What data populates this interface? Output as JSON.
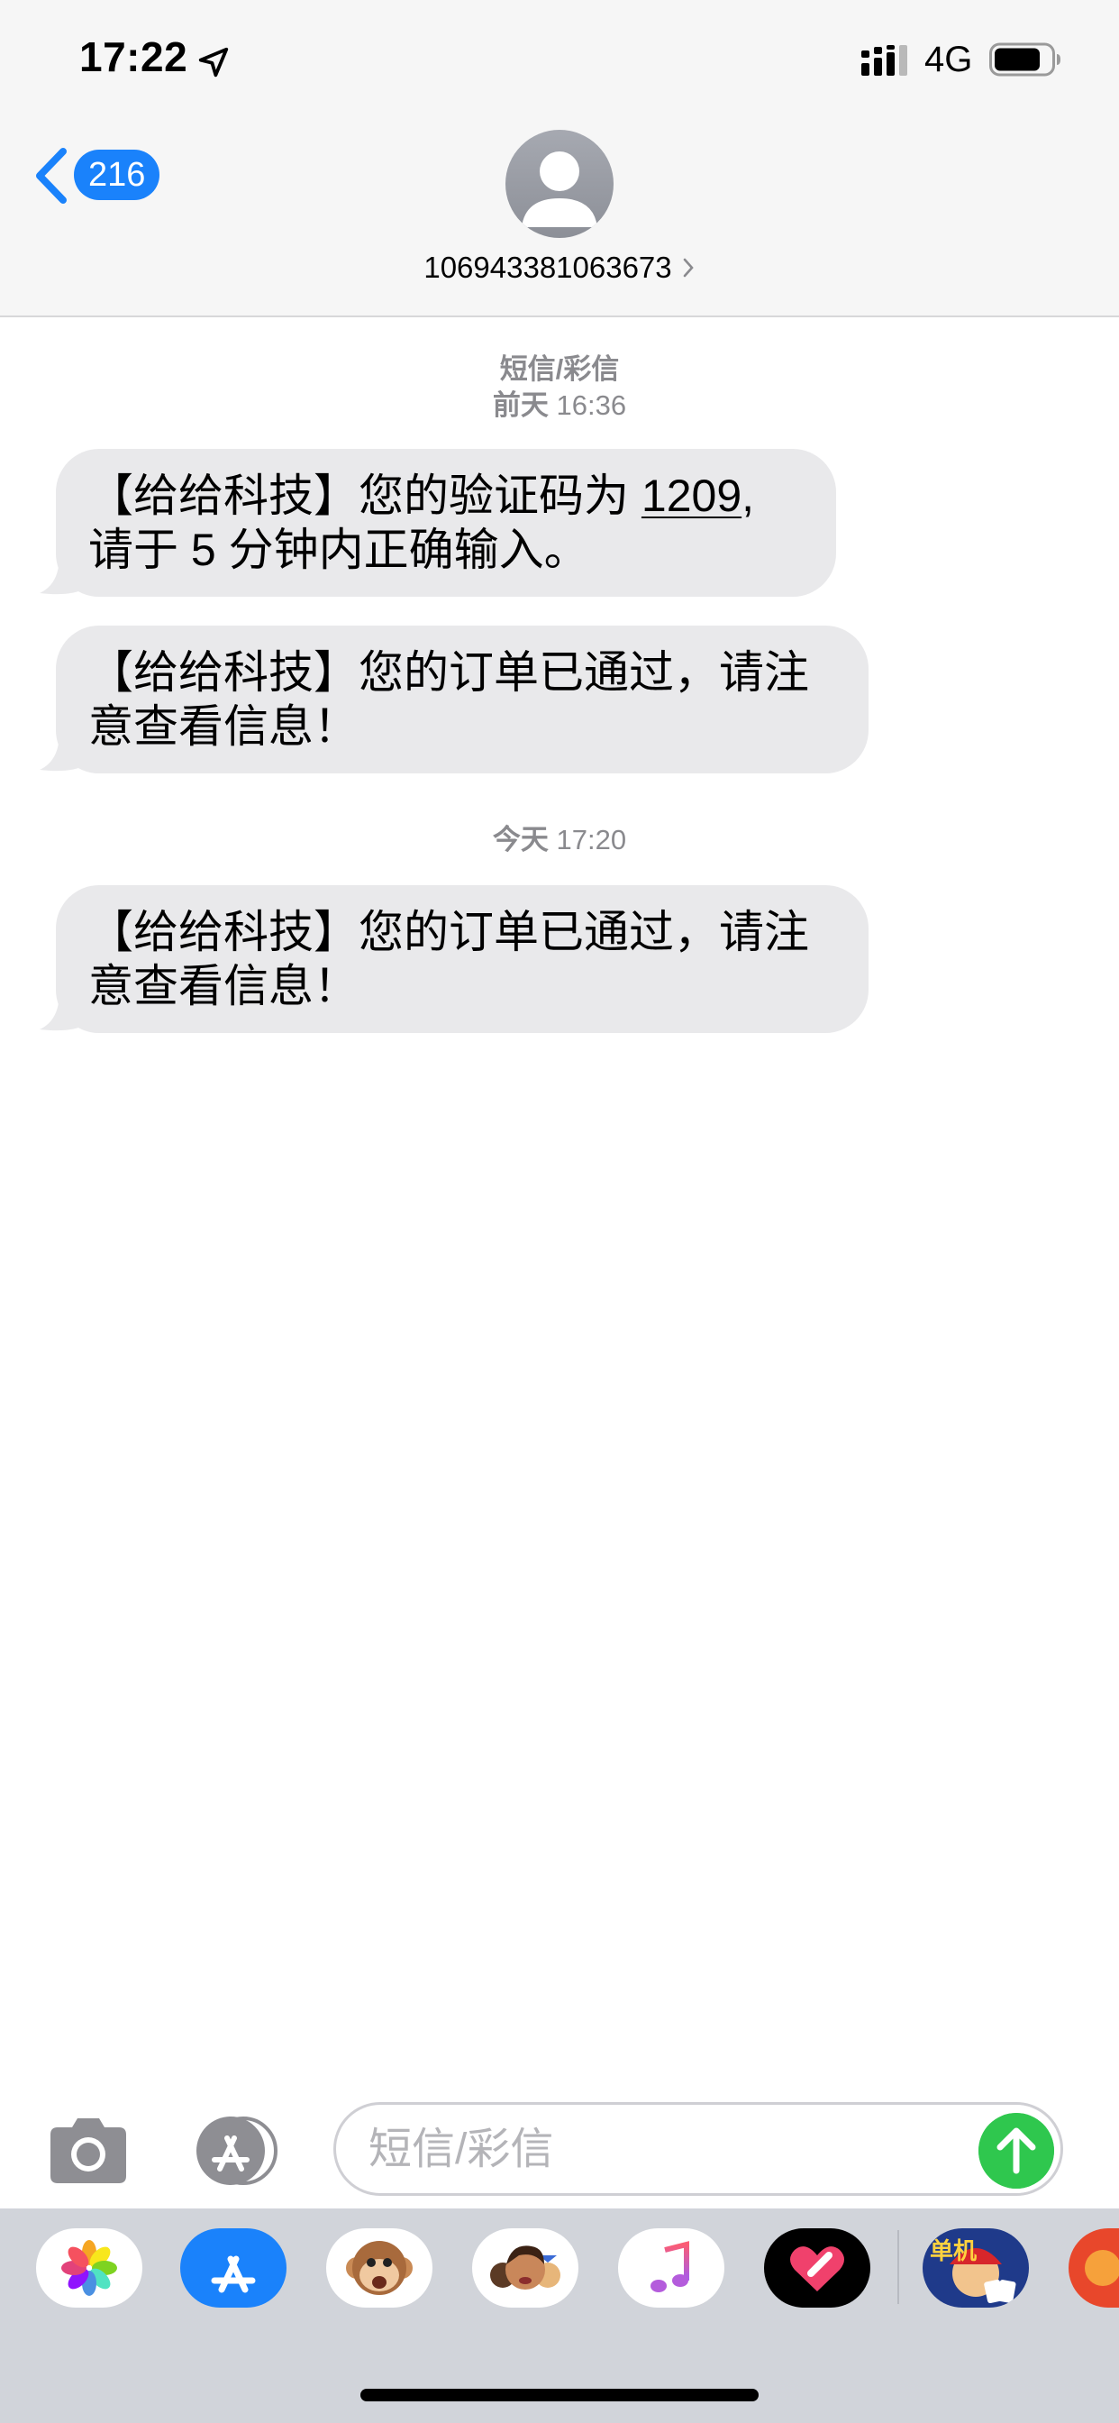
{
  "status_bar": {
    "time": "17:22",
    "network": "4G",
    "icons": [
      "location-arrow-icon",
      "signal-bars-icon",
      "battery-icon"
    ]
  },
  "header": {
    "back_badge": "216",
    "contact_number": "106943381063673",
    "icons": [
      "back-chevron-icon",
      "avatar-person-icon",
      "chevron-right-icon"
    ]
  },
  "conversation": {
    "service_label": "短信/彩信",
    "groups": [
      {
        "timestamp_day": "前天",
        "timestamp_time": "16:36",
        "messages": [
          {
            "line1_prefix": "【给给科技】您的验证码为 ",
            "code": "1209",
            "line1_suffix": ",",
            "line2": "请于 5 分钟内正确输入。"
          },
          {
            "line1": "【给给科技】您的订单已通过，请注",
            "line2": "意查看信息！"
          }
        ]
      },
      {
        "timestamp_day": "今天",
        "timestamp_time": "17:20",
        "messages": [
          {
            "line1": "【给给科技】您的订单已通过，请注",
            "line2": "意查看信息！"
          }
        ]
      }
    ]
  },
  "input_bar": {
    "placeholder": "短信/彩信",
    "icons": [
      "camera-icon",
      "app-store-icon",
      "send-arrow-icon"
    ]
  },
  "app_drawer": {
    "apps": [
      "photos-app-icon",
      "app-store-app-icon",
      "animoji-monkey-icon",
      "memoji-icon",
      "music-app-icon",
      "digital-touch-icon",
      "game-app-icon",
      "partial-app-icon"
    ],
    "game_app_text": "单机",
    "colors": {
      "accent": "#1a82fb",
      "send": "#2fc74e",
      "bubble": "#e9e9eb"
    }
  }
}
